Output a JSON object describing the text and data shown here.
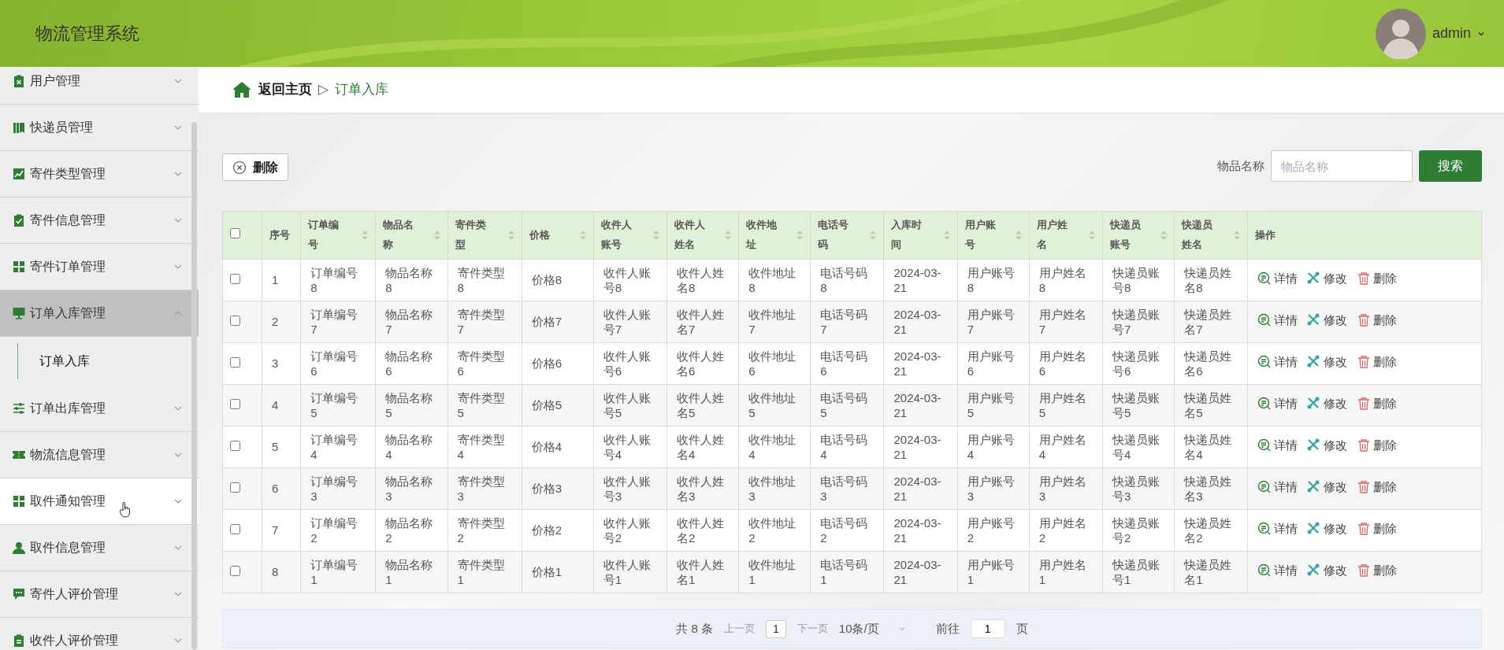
{
  "header": {
    "title": "物流管理系统",
    "user": "admin"
  },
  "sidebar": {
    "items": [
      {
        "label": "用户管理",
        "expanded": false,
        "hovered": false
      },
      {
        "label": "快递员管理",
        "expanded": false,
        "hovered": false
      },
      {
        "label": "寄件类型管理",
        "expanded": false,
        "hovered": false
      },
      {
        "label": "寄件信息管理",
        "expanded": false,
        "hovered": false
      },
      {
        "label": "寄件订单管理",
        "expanded": false,
        "hovered": false
      },
      {
        "label": "订单入库管理",
        "expanded": true,
        "hovered": false,
        "children": [
          {
            "label": "订单入库",
            "selected": true
          }
        ]
      },
      {
        "label": "订单出库管理",
        "expanded": false,
        "hovered": false
      },
      {
        "label": "物流信息管理",
        "expanded": false,
        "hovered": false
      },
      {
        "label": "取件通知管理",
        "expanded": false,
        "hovered": true
      },
      {
        "label": "取件信息管理",
        "expanded": false,
        "hovered": false
      },
      {
        "label": "寄件人评价管理",
        "expanded": false,
        "hovered": false
      },
      {
        "label": "收件人评价管理",
        "expanded": false,
        "hovered": false
      }
    ]
  },
  "breadcrumb": {
    "home": "返回主页",
    "separator": "▷",
    "current": "订单入库"
  },
  "toolbar": {
    "delete_button": "删除",
    "search_label": "物品名称",
    "search_placeholder": "物品名称",
    "search_button": "搜索"
  },
  "table": {
    "all_checked": false,
    "columns": [
      {
        "label": "序号",
        "sortable": false
      },
      {
        "label": "订单编号",
        "sortable": true
      },
      {
        "label": "物品名称",
        "sortable": true
      },
      {
        "label": "寄件类型",
        "sortable": true
      },
      {
        "label": "价格",
        "sortable": true
      },
      {
        "label": "收件人账号",
        "sortable": true
      },
      {
        "label": "收件人姓名",
        "sortable": true
      },
      {
        "label": "收件地址",
        "sortable": true
      },
      {
        "label": "电话号码",
        "sortable": true
      },
      {
        "label": "入库时间",
        "sortable": true
      },
      {
        "label": "用户账号",
        "sortable": true
      },
      {
        "label": "用户姓名",
        "sortable": true
      },
      {
        "label": "快递员账号",
        "sortable": true
      },
      {
        "label": "快递员姓名",
        "sortable": true
      },
      {
        "label": "操作",
        "sortable": false
      }
    ],
    "rows": [
      {
        "checked": false,
        "cells": [
          "1",
          "订单编号8",
          "物品名称8",
          "寄件类型8",
          "价格8",
          "收件人账号8",
          "收件人姓名8",
          "收件地址8",
          "电话号码8",
          "2024-03-21",
          "用户账号8",
          "用户姓名8",
          "快递员账号8",
          "快递员姓名8"
        ],
        "actions": [
          "详情",
          "修改",
          "删除"
        ]
      },
      {
        "checked": false,
        "cells": [
          "2",
          "订单编号7",
          "物品名称7",
          "寄件类型7",
          "价格7",
          "收件人账号7",
          "收件人姓名7",
          "收件地址7",
          "电话号码7",
          "2024-03-21",
          "用户账号7",
          "用户姓名7",
          "快递员账号7",
          "快递员姓名7"
        ],
        "actions": [
          "详情",
          "修改",
          "删除"
        ]
      },
      {
        "checked": false,
        "cells": [
          "3",
          "订单编号6",
          "物品名称6",
          "寄件类型6",
          "价格6",
          "收件人账号6",
          "收件人姓名6",
          "收件地址6",
          "电话号码6",
          "2024-03-21",
          "用户账号6",
          "用户姓名6",
          "快递员账号6",
          "快递员姓名6"
        ],
        "actions": [
          "详情",
          "修改",
          "删除"
        ]
      },
      {
        "checked": false,
        "cells": [
          "4",
          "订单编号5",
          "物品名称5",
          "寄件类型5",
          "价格5",
          "收件人账号5",
          "收件人姓名5",
          "收件地址5",
          "电话号码5",
          "2024-03-21",
          "用户账号5",
          "用户姓名5",
          "快递员账号5",
          "快递员姓名5"
        ],
        "actions": [
          "详情",
          "修改",
          "删除"
        ]
      },
      {
        "checked": false,
        "cells": [
          "5",
          "订单编号4",
          "物品名称4",
          "寄件类型4",
          "价格4",
          "收件人账号4",
          "收件人姓名4",
          "收件地址4",
          "电话号码4",
          "2024-03-21",
          "用户账号4",
          "用户姓名4",
          "快递员账号4",
          "快递员姓名4"
        ],
        "actions": [
          "详情",
          "修改",
          "删除"
        ]
      },
      {
        "checked": false,
        "cells": [
          "6",
          "订单编号3",
          "物品名称3",
          "寄件类型3",
          "价格3",
          "收件人账号3",
          "收件人姓名3",
          "收件地址3",
          "电话号码3",
          "2024-03-21",
          "用户账号3",
          "用户姓名3",
          "快递员账号3",
          "快递员姓名3"
        ],
        "actions": [
          "详情",
          "修改",
          "删除"
        ]
      },
      {
        "checked": false,
        "cells": [
          "7",
          "订单编号2",
          "物品名称2",
          "寄件类型2",
          "价格2",
          "收件人账号2",
          "收件人姓名2",
          "收件地址2",
          "电话号码2",
          "2024-03-21",
          "用户账号2",
          "用户姓名2",
          "快递员账号2",
          "快递员姓名2"
        ],
        "actions": [
          "详情",
          "修改",
          "删除"
        ]
      },
      {
        "checked": false,
        "cells": [
          "8",
          "订单编号1",
          "物品名称1",
          "寄件类型1",
          "价格1",
          "收件人账号1",
          "收件人姓名1",
          "收件地址1",
          "电话号码1",
          "2024-03-21",
          "用户账号1",
          "用户姓名1",
          "快递员账号1",
          "快递员姓名1"
        ],
        "actions": [
          "详情",
          "修改",
          "删除"
        ]
      }
    ]
  },
  "pagination": {
    "total": "共 8 条",
    "prev": "上一页",
    "page": "1",
    "next": "下一页",
    "page_size": "10条/页",
    "goto_label": "前往",
    "goto_value": "1",
    "goto_suffix": "页"
  }
}
